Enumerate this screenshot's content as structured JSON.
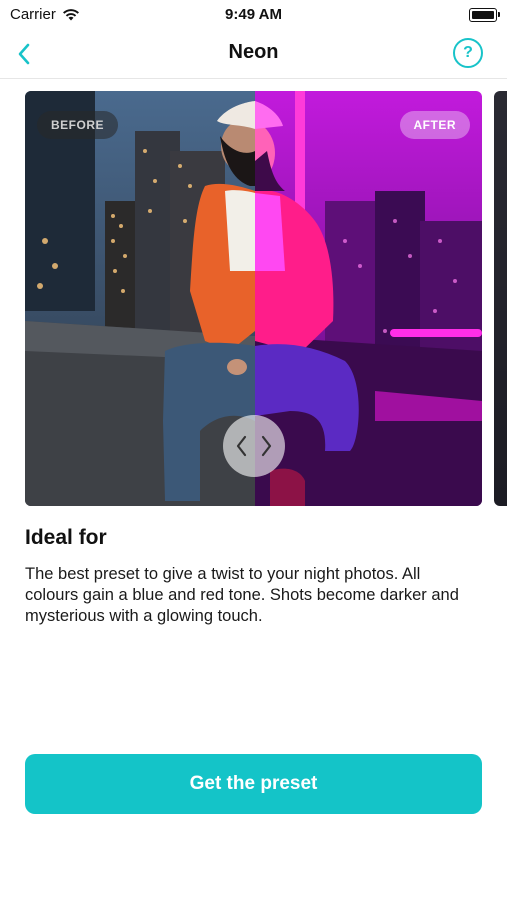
{
  "status_bar": {
    "carrier": "Carrier",
    "time": "9:49 AM"
  },
  "nav": {
    "title": "Neon",
    "help_symbol": "?"
  },
  "comparison": {
    "before_label": "BEFORE",
    "after_label": "AFTER",
    "slider_position": 0.5
  },
  "content": {
    "heading": "Ideal for",
    "description": "The best preset to give a twist to your night photos. All colours gain a blue and red tone. Shots become darker and mysterious with a glowing touch."
  },
  "cta": {
    "label": "Get the preset"
  },
  "colors": {
    "accent": "#14c4c8",
    "after_tint": "#d21fe0"
  },
  "icons": [
    "wifi-icon",
    "battery-icon",
    "chevron-left-icon",
    "help-icon",
    "chevron-left-right-icon"
  ]
}
